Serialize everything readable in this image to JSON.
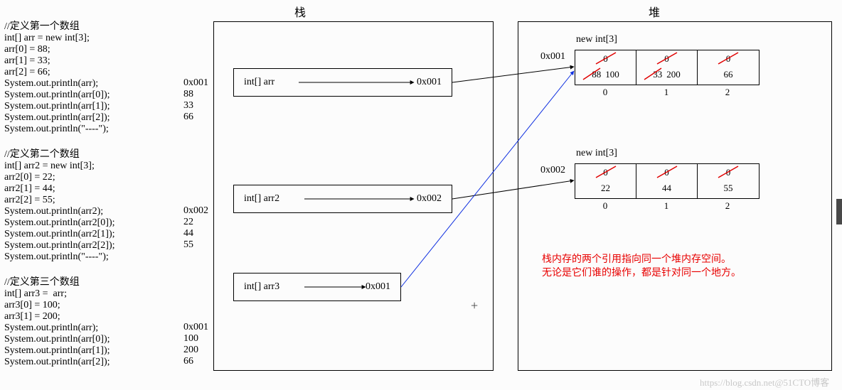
{
  "titles": {
    "stack": "栈",
    "heap": "堆"
  },
  "code": {
    "block1": "//定义第一个数组\nint[] arr = new int[3];\narr[0] = 88;\narr[1] = 33;\narr[2] = 66;\nSystem.out.println(arr);\nSystem.out.println(arr[0]);\nSystem.out.println(arr[1]);\nSystem.out.println(arr[2]);\nSystem.out.println(\"----\");",
    "block2": "//定义第二个数组\nint[] arr2 = new int[3];\narr2[0] = 22;\narr2[1] = 44;\narr2[2] = 55;\nSystem.out.println(arr2);\nSystem.out.println(arr2[0]);\nSystem.out.println(arr2[1]);\nSystem.out.println(arr2[2]);\nSystem.out.println(\"----\");",
    "block3": "//定义第三个数组\nint[] arr3 =  arr;\narr3[0] = 100;\narr3[1] = 200;\nSystem.out.println(arr);\nSystem.out.println(arr[0]);\nSystem.out.println(arr[1]);\nSystem.out.println(arr[2]);",
    "out1": "0x001\n88\n33\n66",
    "out2": "0x002\n22\n44\n55",
    "out3": "0x001\n100\n200\n66"
  },
  "stack": {
    "frames": [
      {
        "label": "int[] arr",
        "addr": "0x001"
      },
      {
        "label": "int[] arr2",
        "addr": "0x002"
      },
      {
        "label": "int[] arr3",
        "addr": "0x001"
      }
    ]
  },
  "heap": {
    "arrays": [
      {
        "decl": "new int[3]",
        "addr": "0x001",
        "cells": [
          {
            "init": "0",
            "old": "88",
            "val": "100"
          },
          {
            "init": "0",
            "old": "33",
            "val": "200"
          },
          {
            "init": "0",
            "val": "66"
          }
        ],
        "indices": [
          "0",
          "1",
          "2"
        ]
      },
      {
        "decl": "new int[3]",
        "addr": "0x002",
        "cells": [
          {
            "init": "0",
            "val": "22"
          },
          {
            "init": "0",
            "val": "44"
          },
          {
            "init": "0",
            "val": "55"
          }
        ],
        "indices": [
          "0",
          "1",
          "2"
        ]
      }
    ]
  },
  "note": "栈内存的两个引用指向同一个堆内存空间。\n无论是它们谁的操作，都是针对同一个地方。",
  "watermark": "https://blog.csdn.net@51CTO博客",
  "chart_data": {
    "type": "table",
    "description": "Java array memory diagram: stack frames holding references to heap int[3] arrays",
    "stack_frames": [
      {
        "var": "int[] arr",
        "ref": "0x001"
      },
      {
        "var": "int[] arr2",
        "ref": "0x002"
      },
      {
        "var": "int[] arr3",
        "ref": "0x001"
      }
    ],
    "heap_objects": {
      "0x001": {
        "type": "int[3]",
        "initial": [
          0,
          0,
          0
        ],
        "after_assign": [
          88,
          33,
          66
        ],
        "final": [
          100,
          200,
          66
        ]
      },
      "0x002": {
        "type": "int[3]",
        "initial": [
          0,
          0,
          0
        ],
        "final": [
          22,
          44,
          55
        ]
      }
    },
    "console_output": [
      "0x001",
      88,
      33,
      66,
      "----",
      "0x002",
      22,
      44,
      55,
      "----",
      "0x001",
      100,
      200,
      66
    ],
    "note_translation": "Two references in stack memory point to the same heap memory space. Whichever one operates, both target the same place."
  }
}
